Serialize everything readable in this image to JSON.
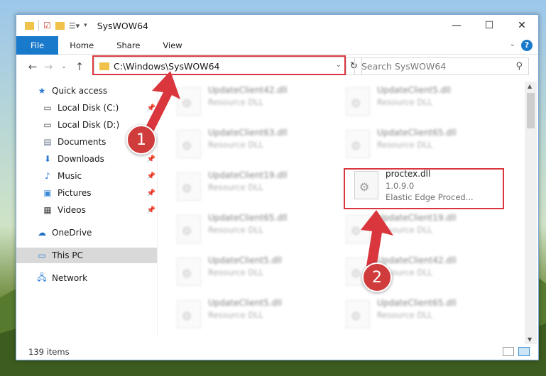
{
  "window": {
    "title": "SysWOW64"
  },
  "title_controls": {
    "minimize": "—",
    "maximize": "☐",
    "close": "✕"
  },
  "ribbon": {
    "tabs": [
      "File",
      "Home",
      "Share",
      "View"
    ],
    "help": "?"
  },
  "nav": {
    "address": "C:\\Windows\\SysWOW64",
    "search_placeholder": "Search SysWOW64"
  },
  "sidebar": {
    "items": [
      {
        "label": "Quick access",
        "icon": "star-icon",
        "pinned": false
      },
      {
        "label": "Local Disk (C:)",
        "icon": "drive-icon",
        "pinned": true
      },
      {
        "label": "Local Disk (D:)",
        "icon": "drive-icon",
        "pinned": true
      },
      {
        "label": "Documents",
        "icon": "document-icon",
        "pinned": true
      },
      {
        "label": "Downloads",
        "icon": "download-icon",
        "pinned": true
      },
      {
        "label": "Music",
        "icon": "music-icon",
        "pinned": true
      },
      {
        "label": "Pictures",
        "icon": "pictures-icon",
        "pinned": true
      },
      {
        "label": "Videos",
        "icon": "videos-icon",
        "pinned": true
      },
      {
        "label": "OneDrive",
        "icon": "cloud-icon",
        "pinned": false
      },
      {
        "label": "This PC",
        "icon": "computer-icon",
        "pinned": false,
        "selected": true
      },
      {
        "label": "Network",
        "icon": "network-icon",
        "pinned": false
      }
    ]
  },
  "files": [
    {
      "name": "UpdateClient42.dll",
      "line2": "Resource DLL"
    },
    {
      "name": "UpdateClient5.dll",
      "line2": "Resource DLL"
    },
    {
      "name": "UpdateClient63.dll",
      "line2": "Resource DLL"
    },
    {
      "name": "UpdateClient65.dll",
      "line2": "Resource DLL"
    },
    {
      "name": "UpdateClient19.dll",
      "line2": "Resource DLL"
    },
    {
      "name": "proctex.dll",
      "line2": "1.0.9.0",
      "line3": "Elastic Edge Proced..."
    },
    {
      "name": "UpdateClient65.dll",
      "line2": "Resource DLL"
    },
    {
      "name": "UpdateClient19.dll",
      "line2": "Resource DLL"
    },
    {
      "name": "UpdateClient5.dll",
      "line2": "Resource DLL"
    },
    {
      "name": "UpdateClient42.dll",
      "line2": "Resource DLL"
    },
    {
      "name": "UpdateClient5.dll",
      "line2": "Resource DLL"
    },
    {
      "name": "UpdateClient65.dll",
      "line2": "Resource DLL"
    }
  ],
  "status": {
    "item_count": "139 items"
  },
  "annotations": {
    "step1": "1",
    "step2": "2",
    "color": "#d9363e"
  }
}
